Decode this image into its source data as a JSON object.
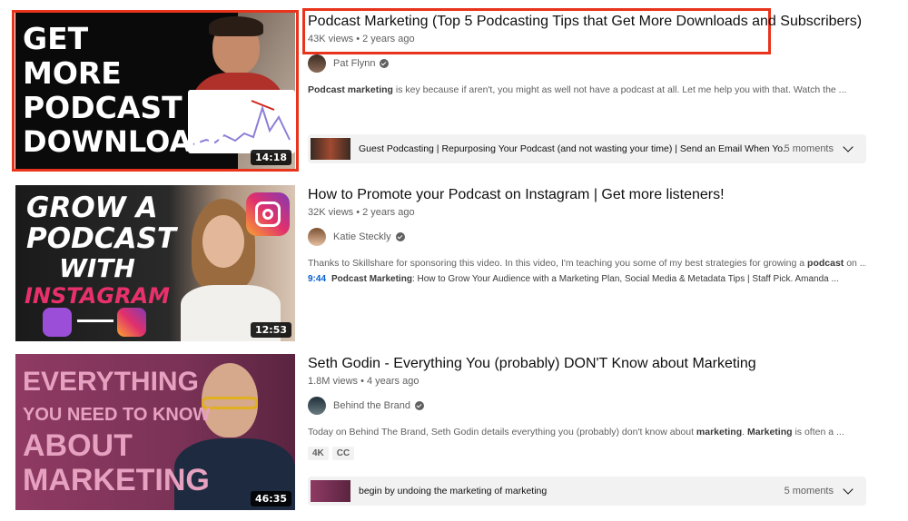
{
  "results": [
    {
      "title": "Podcast Marketing (Top 5 Podcasting Tips that Get More Downloads and Subscribers)",
      "meta": "43K views • 2 years ago",
      "channel": "Pat Flynn",
      "description_bold": "Podcast marketing",
      "description_rest": " is key because if aren't, you might as well not have a podcast at all. Let me help you with that. Watch the ...",
      "duration": "14:18",
      "thumb_lines": [
        "GET",
        "MORE",
        "PODCAST",
        "DOWNLOADS"
      ],
      "moments_text": "Guest Podcasting | Repurposing Your Podcast (and not wasting your time) | Send an Email When Yo...",
      "moments_count": "5 moments"
    },
    {
      "title": "How to Promote your Podcast on Instagram | Get more listeners!",
      "meta": "32K views • 2 years ago",
      "channel": "Katie Steckly",
      "description_pre": "Thanks to Skillshare for sponsoring this video. In this video, I'm teaching you some of my best strategies for growing a ",
      "description_bold": "podcast",
      "description_post": " on ...",
      "duration": "12:53",
      "thumb_lines": [
        "GROW A",
        "PODCAST",
        "WITH",
        "INSTAGRAM"
      ],
      "chapter_ts": "9:44",
      "chapter_bold": "Podcast Marketing",
      "chapter_rest": ": How to Grow Your Audience with a Marketing Plan, Social Media & Metadata Tips | Staff Pick. Amanda ..."
    },
    {
      "title": "Seth Godin - Everything You (probably) DON'T Know about Marketing",
      "meta": "1.8M views • 4 years ago",
      "channel": "Behind the Brand",
      "description_pre": "Today on Behind The Brand, Seth Godin details everything you (probably) don't know about ",
      "description_bold1": "marketing",
      "description_mid": ". ",
      "description_bold2": "Marketing",
      "description_post": " is often a ...",
      "duration": "46:35",
      "thumb_lines": [
        "EVERYTHING",
        "YOU NEED TO KNOW",
        "ABOUT",
        "MARKETING"
      ],
      "badges": [
        "4K",
        "CC"
      ],
      "moments_text": "begin by undoing the marketing of marketing",
      "moments_count": "5 moments"
    }
  ],
  "colors": {
    "highlight": "#e8341c",
    "link": "#065fd4"
  }
}
